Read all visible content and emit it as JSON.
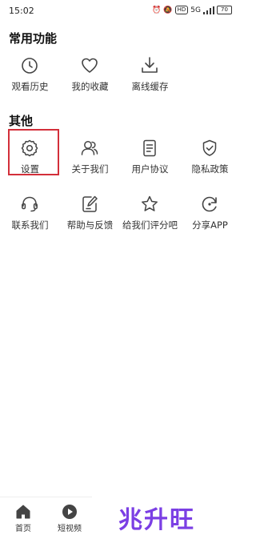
{
  "status_bar": {
    "time": "15:02",
    "network_badge": "HD",
    "signal": "5G",
    "battery": "70"
  },
  "sections": [
    {
      "title": "常用功能",
      "items": [
        {
          "label": "观看历史",
          "icon": "clock-icon"
        },
        {
          "label": "我的收藏",
          "icon": "heart-icon"
        },
        {
          "label": "离线缓存",
          "icon": "download-icon"
        }
      ]
    },
    {
      "title": "其他",
      "items": [
        {
          "label": "设置",
          "icon": "gear-icon"
        },
        {
          "label": "关于我们",
          "icon": "users-icon"
        },
        {
          "label": "用户协议",
          "icon": "document-icon"
        },
        {
          "label": "隐私政策",
          "icon": "shield-icon"
        },
        {
          "label": "联系我们",
          "icon": "headset-icon"
        },
        {
          "label": "帮助与反馈",
          "icon": "edit-icon"
        },
        {
          "label": "给我们评分吧",
          "icon": "star-icon"
        },
        {
          "label": "分享APP",
          "icon": "share-refresh-icon"
        }
      ]
    }
  ],
  "tab_bar": [
    {
      "label": "首页",
      "icon": "home-icon"
    },
    {
      "label": "短视频",
      "icon": "play-icon"
    }
  ],
  "watermark": "兆升旺",
  "highlight_color": "#d32f3a"
}
